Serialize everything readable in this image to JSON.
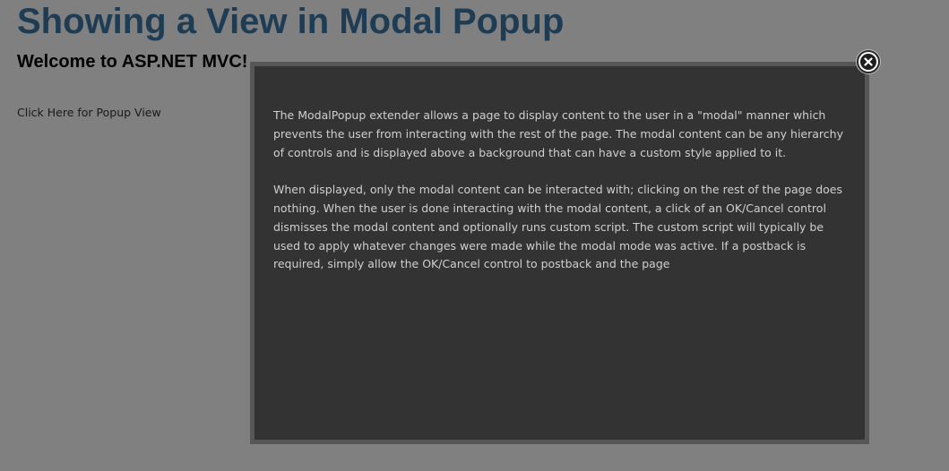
{
  "page": {
    "title": "Showing a View in Modal Popup",
    "subtitle": "Welcome to ASP.NET MVC!",
    "link_label": "Click Here for Popup View"
  },
  "modal": {
    "paragraphs": [
      "The ModalPopup extender allows a page to display content to the user in a \"modal\" manner which prevents the user from interacting with the rest of the page. The modal content can be any hierarchy of controls and is displayed above a background that can have a custom style applied to it.",
      "When displayed, only the modal content can be interacted with; clicking on the rest of the page does nothing. When the user is done interacting with the modal content, a click of an OK/Cancel control dismisses the modal content and optionally runs custom script. The custom script will typically be used to apply whatever changes were made while the modal mode was active. If a postback is required, simply allow the OK/Cancel control to postback and the page"
    ],
    "close_icon": "close-icon"
  },
  "colors": {
    "overlay_background": "#808080",
    "title": "#1e3d55",
    "modal_background": "#333333",
    "modal_border": "#575757",
    "modal_text": "#cfcfcf"
  }
}
